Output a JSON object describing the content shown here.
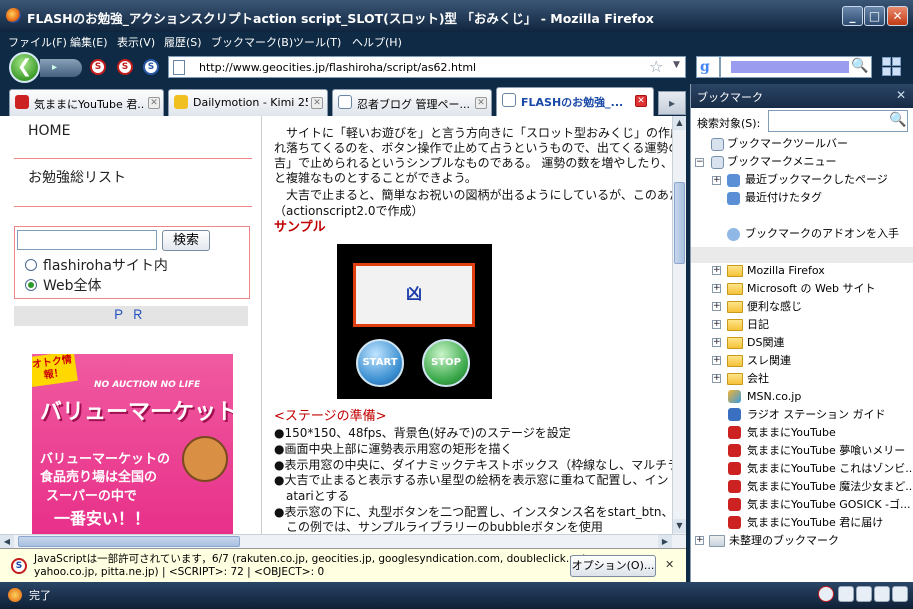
{
  "window": {
    "title": "FLASHのお勉強_アクションスクリプトaction script_SLOT(スロット)型 「おみくじ」 - Mozilla Firefox",
    "min": "_",
    "max": "□",
    "close": "✕"
  },
  "menu": [
    "ファイル(F)",
    "編集(E)",
    "表示(V)",
    "履歴(S)",
    "ブックマーク(B)",
    "ツール(T)",
    "ヘルプ(H)"
  ],
  "nav": {
    "url": "http://www.geocities.jp/flashiroha/script/as62.html",
    "back": "❮",
    "fwd": "▸"
  },
  "tabs": [
    {
      "label": "気ままにYouTube 君..."
    },
    {
      "label": "Dailymotion - Kimi 25 ..."
    },
    {
      "label": "忍者ブログ 管理ペー..."
    },
    {
      "label": "FLASHのお勉強_..."
    }
  ],
  "left": {
    "home": "HOME",
    "study": "お勉強総リスト",
    "search_btn": "検索",
    "radio1": "flashirohaサイト内",
    "radio2": "Web全体",
    "pr": "ＰＲ",
    "ad": {
      "badge": "オトク情報！",
      "eng": "NO AUCTION NO LIFE",
      "brand": "バリューマーケット",
      "line1": "バリューマーケットの",
      "line2": "食品売り場は全国の",
      "line3": "スーパーの中で",
      "line4": "一番安い！！"
    }
  },
  "article": {
    "p1": "　サイトに「軽いお遊びを」と言う方向きに「スロット型おみくじ」の作成を勉",
    "p2": "れ落ちてくるのを、ボタン操作で止めて占うというもので、出てくる運勢の川",
    "p3": "吉」で止められるというシンプルなものである。 運勢の数を増やしたり、ス",
    "p4": "と複雑なものとすることができよう。",
    "p5": "　大吉で止まると、簡単なお祝いの図柄が出るようにしているが、このあた",
    "p6": "（actionscript2.0で作成）",
    "sample": "サンプル",
    "flash_glyph": "凶",
    "start": "START",
    "stop": "STOP",
    "stage": "<ステージの準備>",
    "b1": "●150*150、48fps、背景色(好みで)のステージを設定",
    "b2": "●画面中央上部に運勢表示用窓の矩形を描く",
    "b3": "●表示用窓の中央に、ダイナミックテキストボックス（枠線なし、マルチライ",
    "b4": "●大吉で止まると表示する赤い星型の絵柄を表示窓に重ねて配置し、イン",
    "b5": "　atariとする",
    "b6": "●表示窓の下に、丸型ボタンを二つ配置し、インスタンス名をstart_btn、s",
    "b7": "　この例では、サンプルライブラリーのbubbleボタンを使用"
  },
  "infobar": {
    "line1": "JavaScriptは一部許可されています，6/7 (rakuten.co.jp, geocities.jp, googlesyndication.com, doubleclick.net,",
    "line2": "yahoo.co.jp, pitta.ne.jp) | <SCRIPT>: 72 | <OBJECT>: 0",
    "option": "オプション(O)..."
  },
  "sidebar": {
    "title": "ブックマーク",
    "search_label": "検索対象(S):",
    "items": [
      {
        "label": "ブックマークツールバー"
      },
      {
        "label": "ブックマークメニュー"
      },
      {
        "label": "最近ブックマークしたページ"
      },
      {
        "label": "最近付けたタグ"
      },
      {
        "label": "ブックマークのアドオンを入手"
      },
      {
        "label": "Mozilla Firefox"
      },
      {
        "label": "Microsoft の Web サイト"
      },
      {
        "label": "便利な感じ"
      },
      {
        "label": "日記"
      },
      {
        "label": "DS関連"
      },
      {
        "label": "スレ関連"
      },
      {
        "label": "会社"
      },
      {
        "label": "MSN.co.jp"
      },
      {
        "label": "ラジオ ステーション ガイド"
      },
      {
        "label": "気ままにYouTube"
      },
      {
        "label": "気ままにYouTube 夢喰いメリー"
      },
      {
        "label": "気ままにYouTube これはゾンビ..."
      },
      {
        "label": "気ままにYouTube 魔法少女まど..."
      },
      {
        "label": "気ままにYouTube GOSICK -ゴ..."
      },
      {
        "label": "気ままにYouTube 君に届け"
      },
      {
        "label": "未整理のブックマーク"
      }
    ]
  },
  "status": {
    "text": "完了"
  }
}
